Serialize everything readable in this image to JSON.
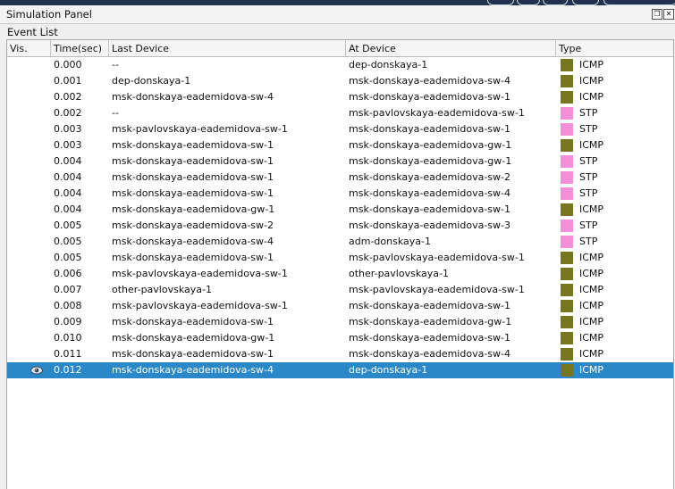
{
  "window": {
    "title": "Simulation Panel"
  },
  "event_list": {
    "label": "Event List",
    "columns": [
      "Vis.",
      "Time(sec)",
      "Last Device",
      "At Device",
      "Type"
    ],
    "type_colors": {
      "ICMP": "#76761f",
      "STP": "#f58fda"
    },
    "rows": [
      {
        "time": "0.000",
        "last": "--",
        "at": "dep-donskaya-1",
        "type": "ICMP"
      },
      {
        "time": "0.001",
        "last": "dep-donskaya-1",
        "at": "msk-donskaya-eademidova-sw-4",
        "type": "ICMP"
      },
      {
        "time": "0.002",
        "last": "msk-donskaya-eademidova-sw-4",
        "at": "msk-donskaya-eademidova-sw-1",
        "type": "ICMP"
      },
      {
        "time": "0.002",
        "last": "--",
        "at": "msk-pavlovskaya-eademidova-sw-1",
        "type": "STP"
      },
      {
        "time": "0.003",
        "last": "msk-pavlovskaya-eademidova-sw-1",
        "at": "msk-donskaya-eademidova-sw-1",
        "type": "STP"
      },
      {
        "time": "0.003",
        "last": "msk-donskaya-eademidova-sw-1",
        "at": "msk-donskaya-eademidova-gw-1",
        "type": "ICMP"
      },
      {
        "time": "0.004",
        "last": "msk-donskaya-eademidova-sw-1",
        "at": "msk-donskaya-eademidova-gw-1",
        "type": "STP"
      },
      {
        "time": "0.004",
        "last": "msk-donskaya-eademidova-sw-1",
        "at": "msk-donskaya-eademidova-sw-2",
        "type": "STP"
      },
      {
        "time": "0.004",
        "last": "msk-donskaya-eademidova-sw-1",
        "at": "msk-donskaya-eademidova-sw-4",
        "type": "STP"
      },
      {
        "time": "0.004",
        "last": "msk-donskaya-eademidova-gw-1",
        "at": "msk-donskaya-eademidova-sw-1",
        "type": "ICMP"
      },
      {
        "time": "0.005",
        "last": "msk-donskaya-eademidova-sw-2",
        "at": "msk-donskaya-eademidova-sw-3",
        "type": "STP"
      },
      {
        "time": "0.005",
        "last": "msk-donskaya-eademidova-sw-4",
        "at": "adm-donskaya-1",
        "type": "STP"
      },
      {
        "time": "0.005",
        "last": "msk-donskaya-eademidova-sw-1",
        "at": "msk-pavlovskaya-eademidova-sw-1",
        "type": "ICMP"
      },
      {
        "time": "0.006",
        "last": "msk-pavlovskaya-eademidova-sw-1",
        "at": "other-pavlovskaya-1",
        "type": "ICMP"
      },
      {
        "time": "0.007",
        "last": "other-pavlovskaya-1",
        "at": "msk-pavlovskaya-eademidova-sw-1",
        "type": "ICMP"
      },
      {
        "time": "0.008",
        "last": "msk-pavlovskaya-eademidova-sw-1",
        "at": "msk-donskaya-eademidova-sw-1",
        "type": "ICMP"
      },
      {
        "time": "0.009",
        "last": "msk-donskaya-eademidova-sw-1",
        "at": "msk-donskaya-eademidova-gw-1",
        "type": "ICMP"
      },
      {
        "time": "0.010",
        "last": "msk-donskaya-eademidova-gw-1",
        "at": "msk-donskaya-eademidova-sw-1",
        "type": "ICMP"
      },
      {
        "time": "0.011",
        "last": "msk-donskaya-eademidova-sw-1",
        "at": "msk-donskaya-eademidova-sw-4",
        "type": "ICMP"
      },
      {
        "time": "0.012",
        "last": "msk-donskaya-eademidova-sw-4",
        "at": "dep-donskaya-1",
        "type": "ICMP",
        "selected": true,
        "visible_icon": "eye-icon"
      }
    ]
  }
}
